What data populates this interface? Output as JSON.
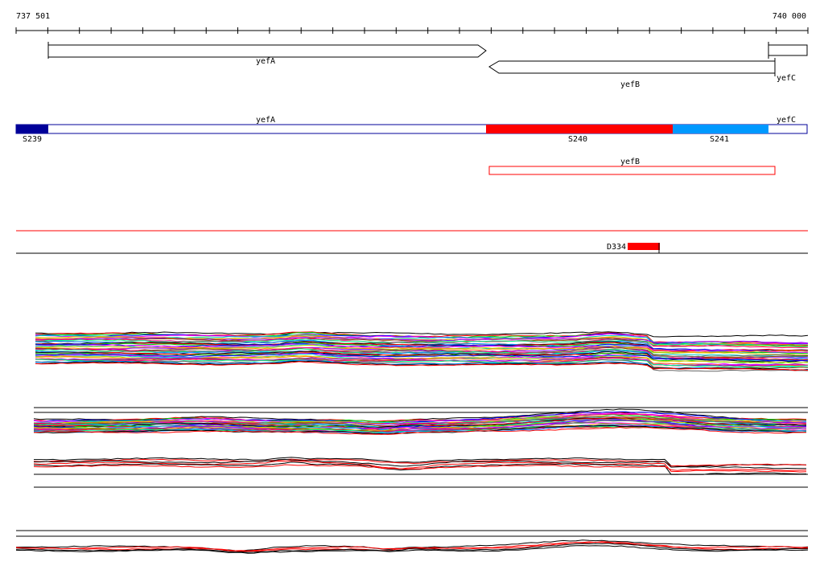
{
  "ruler": {
    "start_label": "737 501",
    "end_label": "740 000"
  },
  "genes": [
    {
      "name": "yefA",
      "strand": "+"
    },
    {
      "name": "yefB",
      "strand": "-"
    },
    {
      "name": "yefC",
      "strand": "+"
    }
  ],
  "segments": {
    "top_labels": [
      "yefA",
      "yefC"
    ],
    "bottom_labels": [
      "S239",
      "S240",
      "S241"
    ],
    "second_row_label": "yefB",
    "colors": {
      "S239": "#000099",
      "S240": "#ff0000",
      "S241": "#0099ff",
      "outline": "#000099"
    }
  },
  "features": [
    {
      "label": "D334",
      "color": "#ff0000"
    }
  ],
  "colors": {
    "accent_red": "#ff0000",
    "line": "#000000"
  }
}
